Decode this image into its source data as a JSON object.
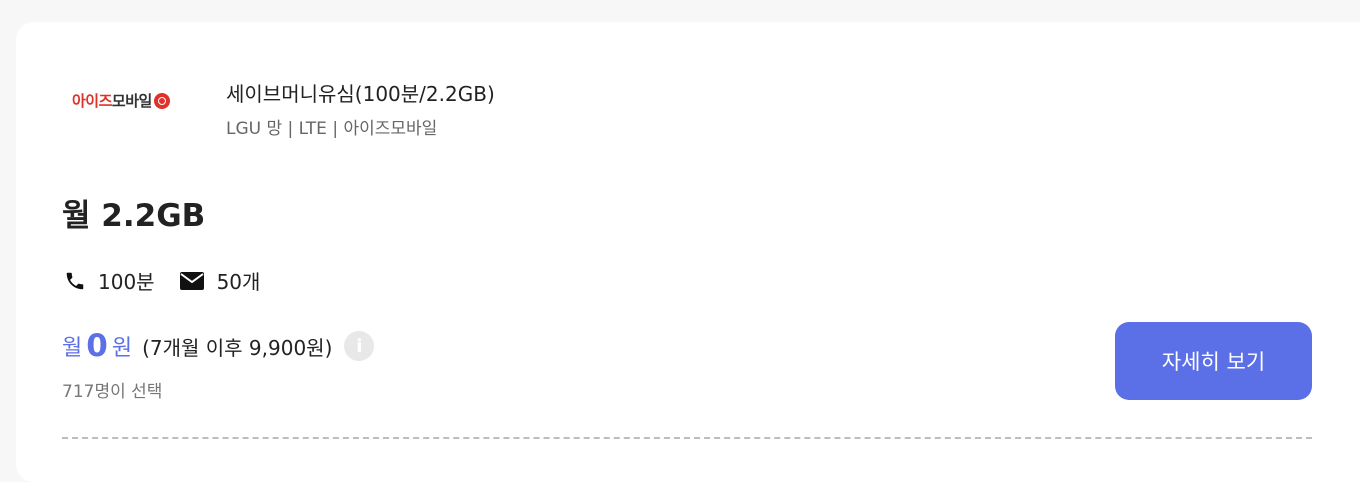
{
  "card": {
    "logo": {
      "part1": "아이즈",
      "part2": "모바일"
    },
    "plan_name": "세이브머니유심(100분/2.2GB)",
    "plan_meta": "LGU 망 | LTE | 아이즈모바일",
    "data_amount": "월 2.2GB",
    "benefits": {
      "call": "100분",
      "sms": "50개"
    },
    "price": {
      "prefix": "월",
      "amount": "0",
      "unit": "원",
      "after": "(7개월 이후 9,900원)"
    },
    "selected_count": "717명이 선택",
    "detail_button": "자세히 보기"
  },
  "colors": {
    "accent": "#5b6fe6",
    "logo_red": "#e0312b"
  },
  "icons": [
    "phone-icon",
    "mail-icon",
    "info-icon",
    "logo-mark-icon"
  ]
}
